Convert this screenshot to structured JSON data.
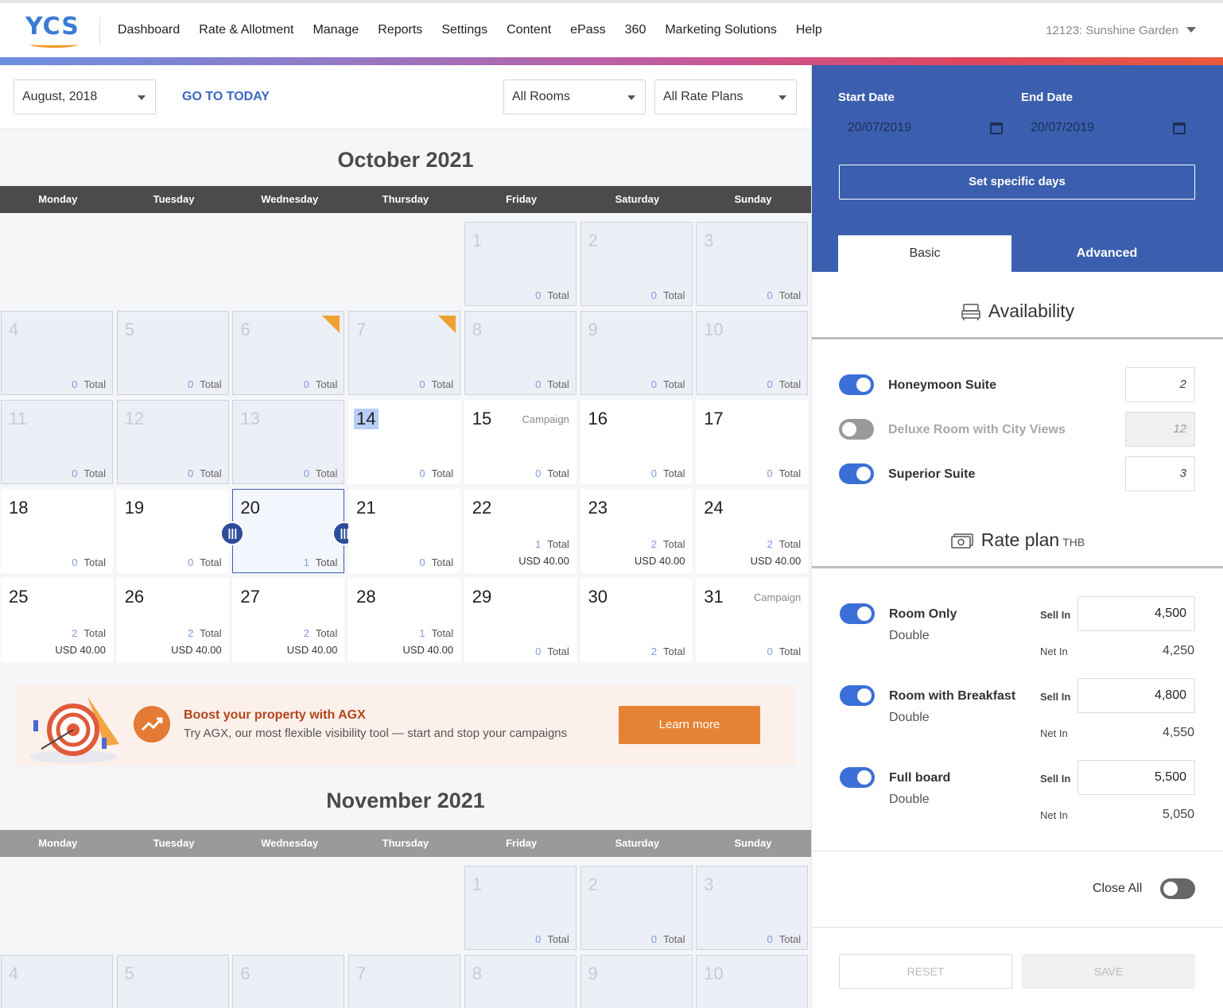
{
  "header": {
    "logo": "YCS",
    "nav": [
      "Dashboard",
      "Rate & Allotment",
      "Manage",
      "Reports",
      "Settings",
      "Content",
      "ePass",
      "360",
      "Marketing Solutions",
      "Help"
    ],
    "property": "12123: Sunshine Garden"
  },
  "filters": {
    "month": "August, 2018",
    "go_today": "GO TO TODAY",
    "rooms": "All Rooms",
    "rate_plans": "All Rate Plans"
  },
  "calendar": {
    "weekdays": [
      "Monday",
      "Tuesday",
      "Wednesday",
      "Thursday",
      "Friday",
      "Saturday",
      "Sunday"
    ],
    "total_label": "Total",
    "campaign_label": "Campaign",
    "october": {
      "title": "October 2021",
      "days": [
        {
          "n": "1",
          "c": "0",
          "past": true
        },
        {
          "n": "2",
          "c": "0",
          "past": true
        },
        {
          "n": "3",
          "c": "0",
          "past": true
        },
        {
          "n": "4",
          "c": "0",
          "past": true
        },
        {
          "n": "5",
          "c": "0",
          "past": true
        },
        {
          "n": "6",
          "c": "0",
          "past": true,
          "flag": true
        },
        {
          "n": "7",
          "c": "0",
          "past": true,
          "flag": true
        },
        {
          "n": "8",
          "c": "0",
          "past": true
        },
        {
          "n": "9",
          "c": "0",
          "past": true
        },
        {
          "n": "10",
          "c": "0",
          "past": true
        },
        {
          "n": "11",
          "c": "0",
          "past": true
        },
        {
          "n": "12",
          "c": "0",
          "past": true
        },
        {
          "n": "13",
          "c": "0",
          "past": true
        },
        {
          "n": "14",
          "c": "0",
          "today": true
        },
        {
          "n": "15",
          "c": "0",
          "campaign": true
        },
        {
          "n": "16",
          "c": "0"
        },
        {
          "n": "17",
          "c": "0"
        },
        {
          "n": "18",
          "c": "0"
        },
        {
          "n": "19",
          "c": "0"
        },
        {
          "n": "20",
          "c": "1",
          "selected": true
        },
        {
          "n": "21",
          "c": "0"
        },
        {
          "n": "22",
          "c": "1",
          "price": "USD 40.00"
        },
        {
          "n": "23",
          "c": "2",
          "price": "USD 40.00"
        },
        {
          "n": "24",
          "c": "2",
          "price": "USD 40.00"
        },
        {
          "n": "25",
          "c": "2",
          "price": "USD 40.00"
        },
        {
          "n": "26",
          "c": "2",
          "price": "USD 40.00"
        },
        {
          "n": "27",
          "c": "2",
          "price": "USD 40.00"
        },
        {
          "n": "28",
          "c": "1",
          "price": "USD 40.00"
        },
        {
          "n": "29",
          "c": "0"
        },
        {
          "n": "30",
          "c": "2"
        },
        {
          "n": "31",
          "c": "0",
          "campaign": true
        }
      ]
    },
    "november": {
      "title": "November 2021",
      "days": [
        {
          "n": "1",
          "c": "0",
          "past": true
        },
        {
          "n": "2",
          "c": "0",
          "past": true
        },
        {
          "n": "3",
          "c": "0",
          "past": true
        },
        {
          "n": "4",
          "past": true
        },
        {
          "n": "5",
          "past": true
        },
        {
          "n": "6",
          "past": true
        },
        {
          "n": "7",
          "past": true
        },
        {
          "n": "8",
          "past": true
        },
        {
          "n": "9",
          "past": true
        },
        {
          "n": "10",
          "past": true
        }
      ]
    }
  },
  "promo": {
    "title": "Boost your property with AGX",
    "text": "Try AGX, our most flexible visibility tool — start and stop your campaigns",
    "button": "Learn more"
  },
  "panel": {
    "start_label": "Start Date",
    "end_label": "End Date",
    "start_date": "20/07/2019",
    "end_date": "20/07/2019",
    "specific_days": "Set specific days",
    "tab_basic": "Basic",
    "tab_advanced": "Advanced",
    "availability_title": "Availability",
    "rooms": [
      {
        "name": "Honeymoon Suite",
        "value": "2",
        "on": true
      },
      {
        "name": "Deluxe Room with City Views",
        "value": "12",
        "on": false
      },
      {
        "name": "Superior Suite",
        "value": "3",
        "on": true
      }
    ],
    "rate_plan_title": "Rate plan",
    "rate_plan_unit": "THB",
    "sell_label": "Sell In",
    "net_label": "Net In",
    "rate_plans": [
      {
        "name": "Room Only",
        "sub": "Double",
        "sell": "4,500",
        "net": "4,250"
      },
      {
        "name": "Room with Breakfast",
        "sub": "Double",
        "sell": "4,800",
        "net": "4,550"
      },
      {
        "name": "Full board",
        "sub": "Double",
        "sell": "5,500",
        "net": "5,050"
      }
    ],
    "close_all": "Close All",
    "reset": "RESET",
    "save": "SAVE"
  }
}
